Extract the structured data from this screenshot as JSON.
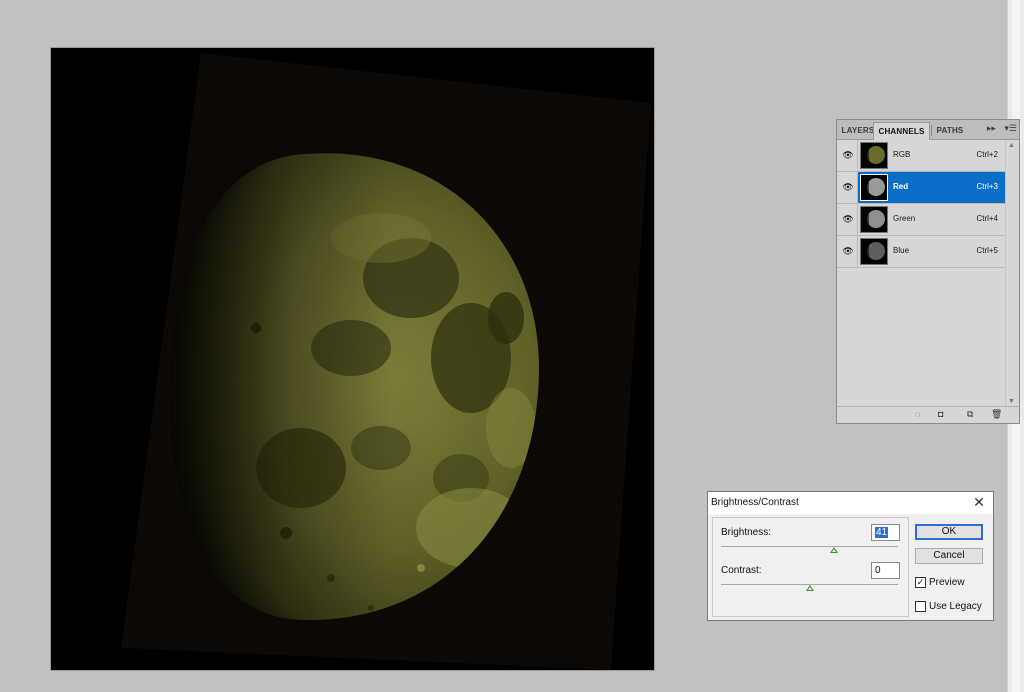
{
  "canvas": {
    "image_subject": "moon"
  },
  "channels_panel": {
    "tabs": [
      {
        "label": "LAYERS"
      },
      {
        "label": "CHANNELS"
      },
      {
        "label": "PATHS"
      }
    ],
    "menu_icons": [
      "collapse-icon",
      "panel-menu-icon"
    ],
    "channels": [
      {
        "name": "RGB",
        "shortcut": "Ctrl+2",
        "selected": false
      },
      {
        "name": "Red",
        "shortcut": "Ctrl+3",
        "selected": true
      },
      {
        "name": "Green",
        "shortcut": "Ctrl+4",
        "selected": false
      },
      {
        "name": "Blue",
        "shortcut": "Ctrl+5",
        "selected": false
      }
    ],
    "selection_color": "#0b6fc7",
    "bottom_icons": [
      "load-selection-icon",
      "save-selection-icon",
      "new-channel-icon",
      "delete-channel-icon"
    ]
  },
  "dialog": {
    "title": "Brightness/Contrast",
    "brightness_label": "Brightness:",
    "brightness_value": "41",
    "contrast_label": "Contrast:",
    "contrast_value": "0",
    "ok_label": "OK",
    "cancel_label": "Cancel",
    "preview_label": "Preview",
    "preview_checked": true,
    "legacy_label": "Use Legacy",
    "legacy_checked": false
  }
}
